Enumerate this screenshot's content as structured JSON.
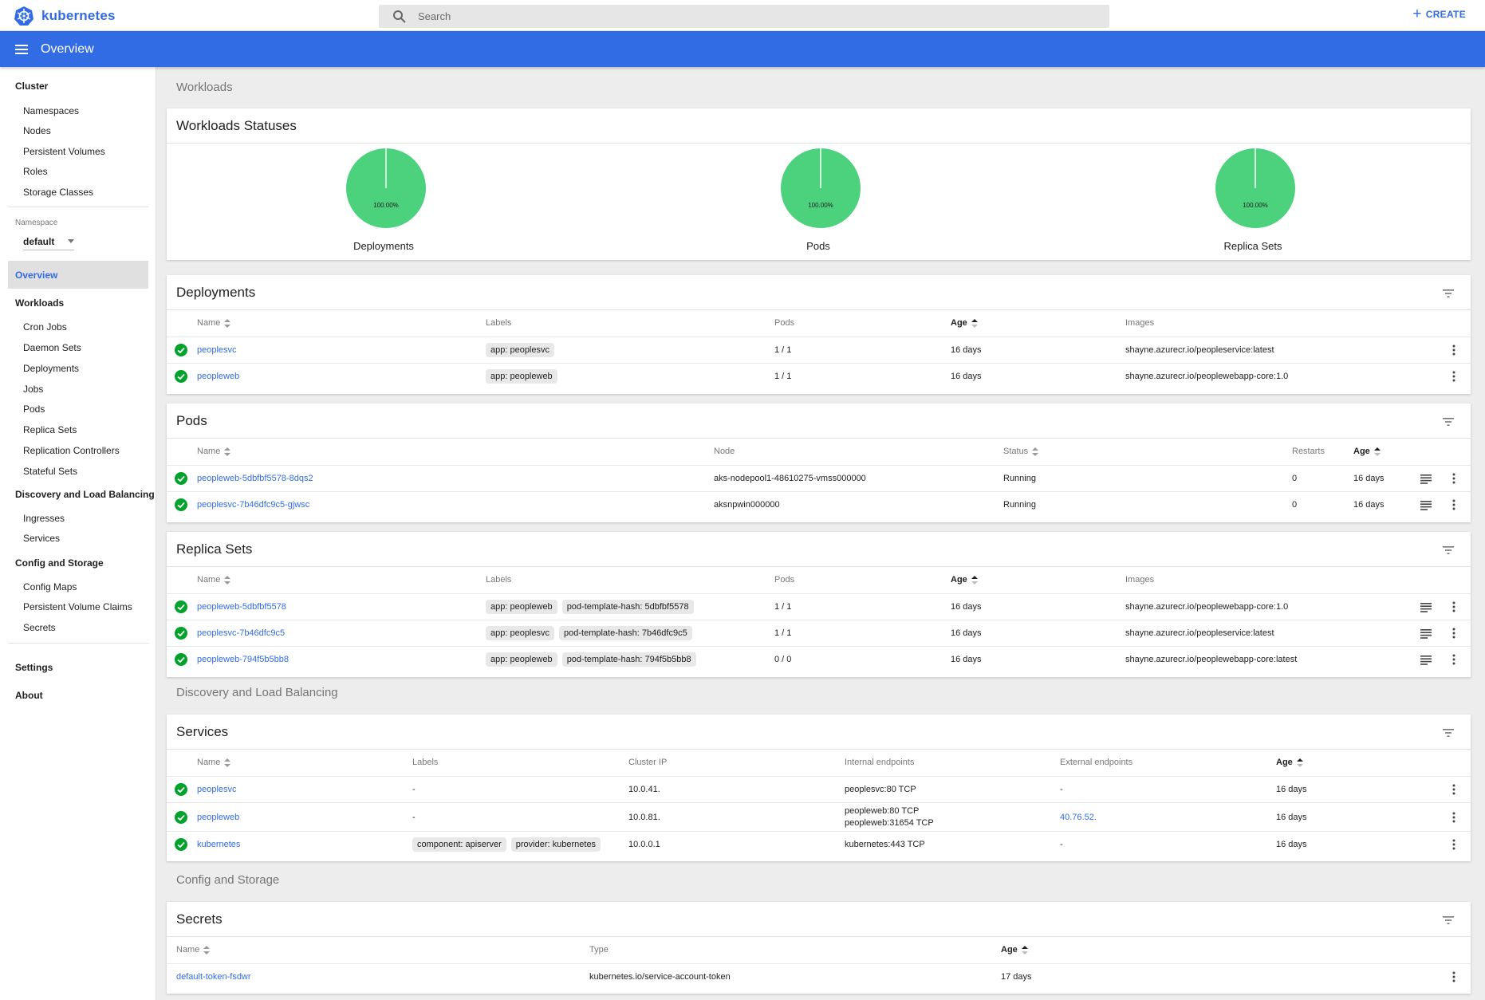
{
  "topbar": {
    "brand": "kubernetes",
    "search_placeholder": "Search",
    "create_label": "CREATE"
  },
  "appbar": {
    "title": "Overview"
  },
  "sidebar": {
    "cluster_heading": "Cluster",
    "cluster_items": [
      "Namespaces",
      "Nodes",
      "Persistent Volumes",
      "Roles",
      "Storage Classes"
    ],
    "namespace_label": "Namespace",
    "namespace_value": "default",
    "overview_label": "Overview",
    "workloads_heading": "Workloads",
    "workloads_items": [
      "Cron Jobs",
      "Daemon Sets",
      "Deployments",
      "Jobs",
      "Pods",
      "Replica Sets",
      "Replication Controllers",
      "Stateful Sets"
    ],
    "discovery_heading": "Discovery and Load Balancing",
    "discovery_items": [
      "Ingresses",
      "Services"
    ],
    "config_heading": "Config and Storage",
    "config_items": [
      "Config Maps",
      "Persistent Volume Claims",
      "Secrets"
    ],
    "settings_label": "Settings",
    "about_label": "About"
  },
  "main": {
    "workloads_section": "Workloads",
    "discovery_section": "Discovery and Load Balancing",
    "config_section": "Config and Storage",
    "statuses": {
      "title": "Workloads Statuses",
      "charts": [
        {
          "label": "Deployments",
          "percent": "100.00%",
          "value": 100
        },
        {
          "label": "Pods",
          "percent": "100.00%",
          "value": 100
        },
        {
          "label": "Replica Sets",
          "percent": "100.00%",
          "value": 100
        }
      ],
      "color_running": "#4cd17c"
    },
    "deployments": {
      "title": "Deployments",
      "headers": [
        "Name",
        "Labels",
        "Pods",
        "Age",
        "Images"
      ],
      "rows": [
        {
          "name": "peoplesvc",
          "labels": [
            "app: peoplesvc"
          ],
          "pods": "1 / 1",
          "age": "16 days",
          "images": "shayne.azurecr.io/peopleservice:latest"
        },
        {
          "name": "peopleweb",
          "labels": [
            "app: peopleweb"
          ],
          "pods": "1 / 1",
          "age": "16 days",
          "images": "shayne.azurecr.io/peoplewebapp-core:1.0"
        }
      ]
    },
    "pods": {
      "title": "Pods",
      "headers": [
        "Name",
        "Node",
        "Status",
        "Restarts",
        "Age"
      ],
      "rows": [
        {
          "name": "peopleweb-5dbfbf5578-8dqs2",
          "node": "aks-nodepool1-48610275-vmss000000",
          "status": "Running",
          "restarts": "0",
          "age": "16 days"
        },
        {
          "name": "peoplesvc-7b46dfc9c5-gjwsc",
          "node": "aksnpwin000000",
          "status": "Running",
          "restarts": "0",
          "age": "16 days"
        }
      ]
    },
    "replicasets": {
      "title": "Replica Sets",
      "headers": [
        "Name",
        "Labels",
        "Pods",
        "Age",
        "Images"
      ],
      "rows": [
        {
          "name": "peopleweb-5dbfbf5578",
          "labels": [
            "app: peopleweb",
            "pod-template-hash: 5dbfbf5578"
          ],
          "pods": "1 / 1",
          "age": "16 days",
          "images": "shayne.azurecr.io/peoplewebapp-core:1.0"
        },
        {
          "name": "peoplesvc-7b46dfc9c5",
          "labels": [
            "app: peoplesvc",
            "pod-template-hash: 7b46dfc9c5"
          ],
          "pods": "1 / 1",
          "age": "16 days",
          "images": "shayne.azurecr.io/peopleservice:latest"
        },
        {
          "name": "peopleweb-794f5b5bb8",
          "labels": [
            "app: peopleweb",
            "pod-template-hash: 794f5b5bb8"
          ],
          "pods": "0 / 0",
          "age": "16 days",
          "images": "shayne.azurecr.io/peoplewebapp-core:latest"
        }
      ]
    },
    "services": {
      "title": "Services",
      "headers": [
        "Name",
        "Labels",
        "Cluster IP",
        "Internal endpoints",
        "External endpoints",
        "Age"
      ],
      "rows": [
        {
          "name": "peoplesvc",
          "labels": [
            "-"
          ],
          "cluster_ip": "10.0.41.",
          "internal": [
            "peoplesvc:80 TCP"
          ],
          "external": "-",
          "age": "16 days"
        },
        {
          "name": "peopleweb",
          "labels": [
            "-"
          ],
          "cluster_ip": "10.0.81.",
          "internal": [
            "peopleweb:80 TCP",
            "peopleweb:31654 TCP"
          ],
          "external": "40.76.52.",
          "age": "16 days"
        },
        {
          "name": "kubernetes",
          "labels": [
            "component: apiserver",
            "provider: kubernetes"
          ],
          "cluster_ip": "10.0.0.1",
          "internal": [
            "kubernetes:443 TCP"
          ],
          "external": "-",
          "age": "16 days"
        }
      ]
    },
    "secrets": {
      "title": "Secrets",
      "headers": [
        "Name",
        "Type",
        "Age"
      ],
      "rows": [
        {
          "name": "default-token-fsdwr",
          "type": "kubernetes.io/service-account-token",
          "age": "17 days"
        }
      ]
    }
  }
}
